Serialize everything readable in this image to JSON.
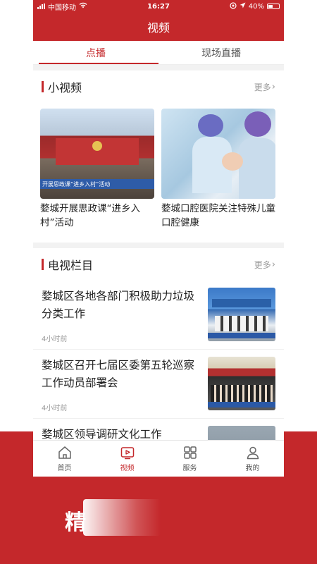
{
  "status": {
    "carrier": "中国移动",
    "time": "16:27",
    "battery": "40%"
  },
  "header": {
    "title": "视频"
  },
  "tabs": [
    {
      "label": "点播",
      "active": true
    },
    {
      "label": "现场直播",
      "active": false
    }
  ],
  "short_videos": {
    "title": "小视频",
    "more": "更多",
    "items": [
      {
        "title": "婺城开展思政课“进乡入村”活动",
        "thumb_caption": "开展思政课“进乡入村”活动"
      },
      {
        "title": "婺城口腔医院关注特殊儿童口腔健康"
      }
    ]
  },
  "tv_columns": {
    "title": "电视栏目",
    "more": "更多",
    "items": [
      {
        "title": "婺城区各地各部门积极助力垃圾分类工作",
        "time": "4小时前"
      },
      {
        "title": "婺城区召开七届区委第五轮巡察工作动员部署会",
        "time": "4小时前"
      },
      {
        "title": "婺城区领导调研文化工作"
      }
    ]
  },
  "tab_bar": [
    {
      "label": "首页",
      "icon": "home-icon",
      "active": false
    },
    {
      "label": "视频",
      "icon": "video-icon",
      "active": true
    },
    {
      "label": "服务",
      "icon": "grid-icon",
      "active": false
    },
    {
      "label": "我的",
      "icon": "user-icon",
      "active": false
    }
  ],
  "banner": {
    "text": "精"
  },
  "colors": {
    "accent": "#c4282b",
    "background": "#f2f2f2"
  }
}
